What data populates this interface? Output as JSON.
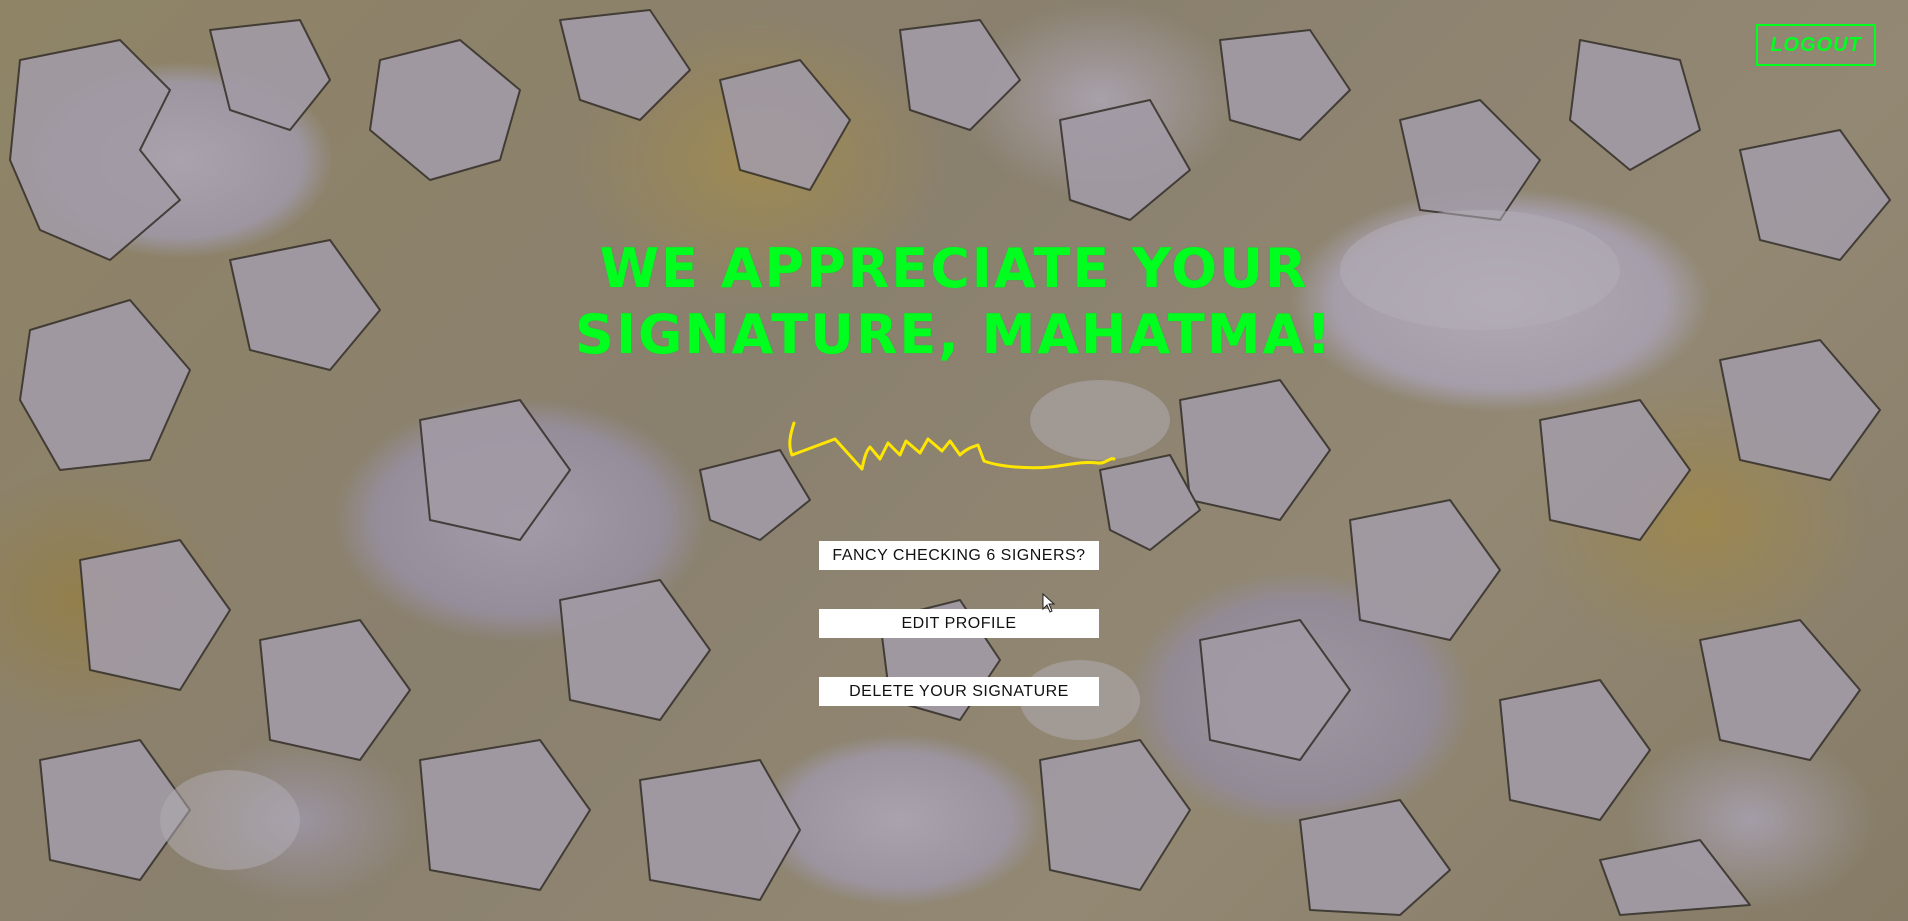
{
  "header": {
    "logout_label": "LOGOUT"
  },
  "main": {
    "headline_line1": "WE APPRECIATE YOUR",
    "headline_line2": "SIGNATURE, MAHATMA!",
    "signature_icon": "handwritten-signature",
    "buttons": {
      "signers_label": "FANCY CHECKING 6 SIGNERS?",
      "edit_label": "EDIT PROFILE",
      "delete_label": "DELETE YOUR SIGNATURE"
    }
  },
  "colors": {
    "accent": "#00ff1e",
    "signature": "#ffe600",
    "button_bg": "#ffffff",
    "button_text": "#111111"
  },
  "background": {
    "description_icon": "peeling-paint-wall-texture"
  }
}
